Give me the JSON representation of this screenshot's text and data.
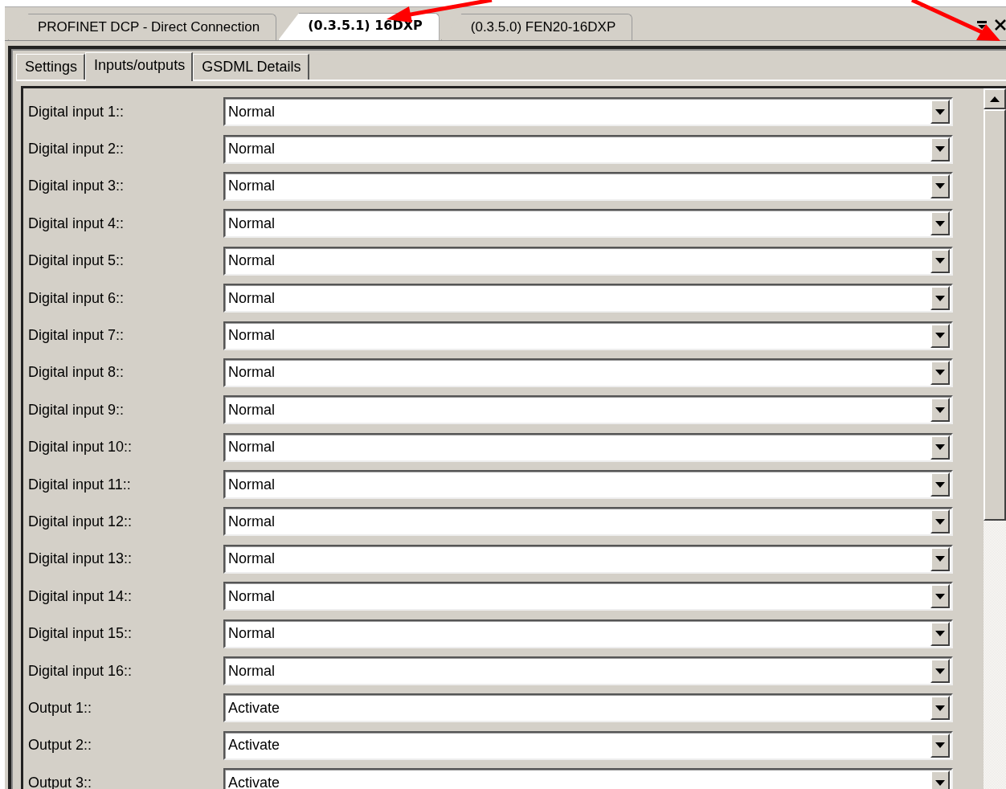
{
  "doc_tabs": [
    {
      "label": "PROFINET DCP - Direct Connection",
      "selected": false
    },
    {
      "label": "(0.3.5.1) 16DXP",
      "selected": true
    },
    {
      "label": "(0.3.5.0) FEN20-16DXP",
      "selected": false
    }
  ],
  "sub_tabs": [
    {
      "label": "Settings",
      "selected": false
    },
    {
      "label": "Inputs/outputs",
      "selected": true
    },
    {
      "label": "GSDML Details",
      "selected": false
    }
  ],
  "parameters": [
    {
      "label": "Digital input 1::",
      "value": "Normal"
    },
    {
      "label": "Digital input 2::",
      "value": "Normal"
    },
    {
      "label": "Digital input 3::",
      "value": "Normal"
    },
    {
      "label": "Digital input 4::",
      "value": "Normal"
    },
    {
      "label": "Digital input 5::",
      "value": "Normal"
    },
    {
      "label": "Digital input 6::",
      "value": "Normal"
    },
    {
      "label": "Digital input 7::",
      "value": "Normal"
    },
    {
      "label": "Digital input 8::",
      "value": "Normal"
    },
    {
      "label": "Digital input 9::",
      "value": "Normal"
    },
    {
      "label": "Digital input 10::",
      "value": "Normal"
    },
    {
      "label": "Digital input 11::",
      "value": "Normal"
    },
    {
      "label": "Digital input 12::",
      "value": "Normal"
    },
    {
      "label": "Digital input 13::",
      "value": "Normal"
    },
    {
      "label": "Digital input 14::",
      "value": "Normal"
    },
    {
      "label": "Digital input 15::",
      "value": "Normal"
    },
    {
      "label": "Digital input 16::",
      "value": "Normal"
    },
    {
      "label": "Output 1::",
      "value": "Activate"
    },
    {
      "label": "Output 2::",
      "value": "Activate"
    },
    {
      "label": "Output 3::",
      "value": "Activate"
    }
  ]
}
